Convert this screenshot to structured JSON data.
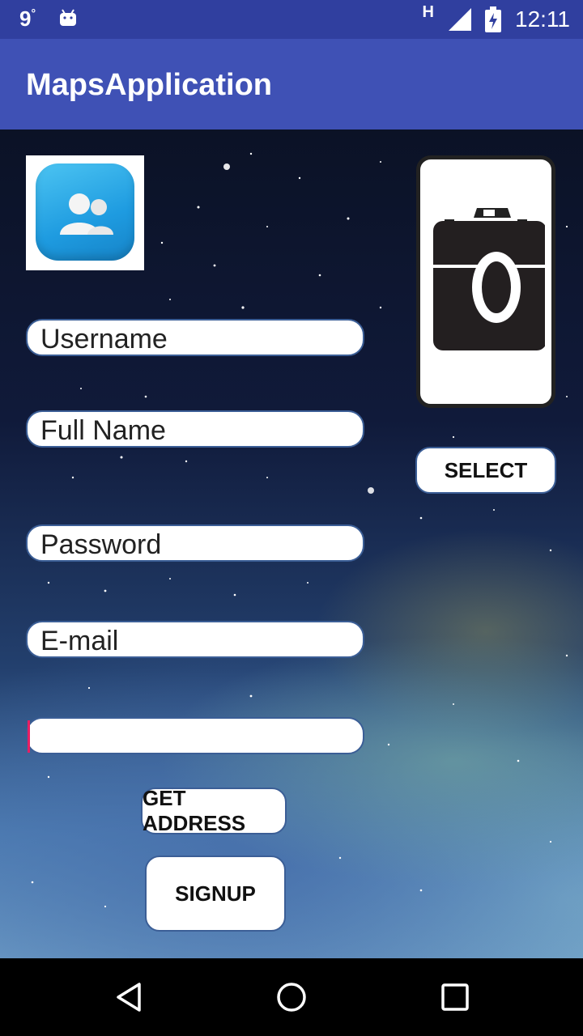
{
  "status_bar": {
    "temperature": "9",
    "temperature_unit": "°",
    "network_type": "H",
    "time": "12:11",
    "icons": [
      "android-notification-icon",
      "signal-icon",
      "battery-charging-icon"
    ]
  },
  "app_bar": {
    "title": "MapsApplication",
    "color": "#3f51b5"
  },
  "form": {
    "avatar_icon": "contacts-icon",
    "fields": [
      {
        "label": "Username",
        "value": ""
      },
      {
        "label": "Full Name",
        "value": ""
      },
      {
        "label": "Password",
        "value": ""
      },
      {
        "label": "E-mail",
        "value": ""
      },
      {
        "label": "",
        "value": ""
      }
    ],
    "camera_icon": "camera-icon",
    "select_button": "SELECT",
    "get_address_button": "GET ADDRESS",
    "signup_button": "SIGNUP"
  },
  "nav_bar": {
    "icons": [
      "back-icon",
      "home-icon",
      "recents-icon"
    ]
  },
  "colors": {
    "status_bar": "#303f9f",
    "field_border": "#3b5e96",
    "caret": "#e91e63"
  }
}
